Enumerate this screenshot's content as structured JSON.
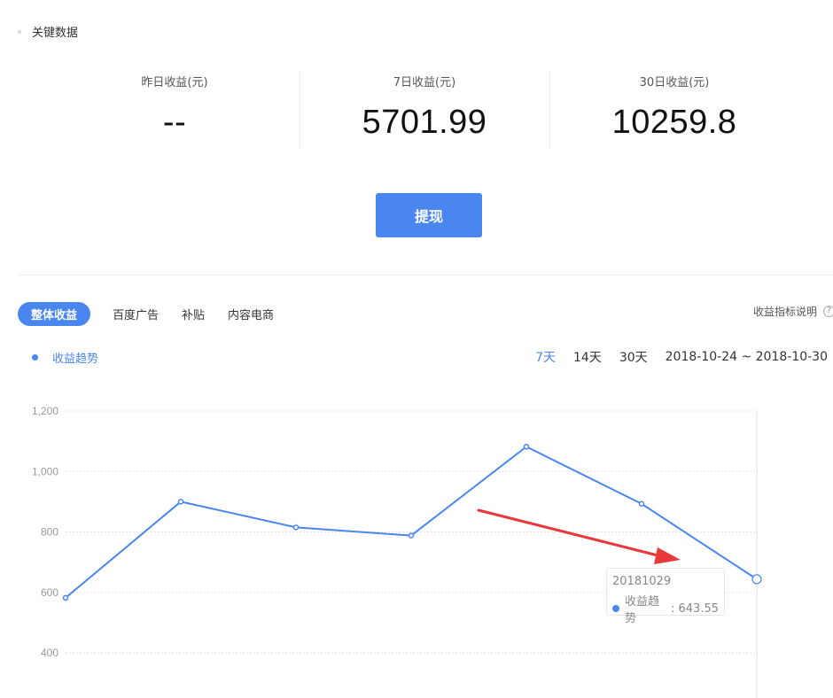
{
  "section": {
    "title": "关键数据"
  },
  "stats": [
    {
      "label": "昨日收益(元)",
      "value": "--"
    },
    {
      "label": "7日收益(元)",
      "value": "5701.99"
    },
    {
      "label": "30日收益(元)",
      "value": "10259.8"
    }
  ],
  "withdraw_label": "提现",
  "tabs": [
    {
      "label": "整体收益",
      "active": true
    },
    {
      "label": "百度广告",
      "active": false
    },
    {
      "label": "补贴",
      "active": false
    },
    {
      "label": "内容电商",
      "active": false
    }
  ],
  "help_label": "收益指标说明",
  "legend_label": "收益趋势",
  "range": {
    "options": [
      "7天",
      "14天",
      "30天"
    ],
    "selected": "7天",
    "dates": "2018-10-24 ~ 2018-10-30"
  },
  "tooltip": {
    "date": "20181029",
    "series": "收益趋势",
    "value": "643.55"
  },
  "colors": {
    "accent": "#4a86f0",
    "annotation_arrow": "#e8383b"
  },
  "chart_data": {
    "type": "line",
    "ylim": [
      400,
      1200
    ],
    "yticks": [
      400,
      600,
      800,
      1000,
      1200
    ],
    "ytick_labels": [
      "400",
      "600",
      "800",
      "1,000",
      "1,200"
    ],
    "grid": true,
    "series": [
      {
        "name": "收益趋势",
        "values": [
          582,
          900,
          815,
          788,
          1082,
          893,
          643.55
        ]
      }
    ],
    "highlight_index": 6
  }
}
